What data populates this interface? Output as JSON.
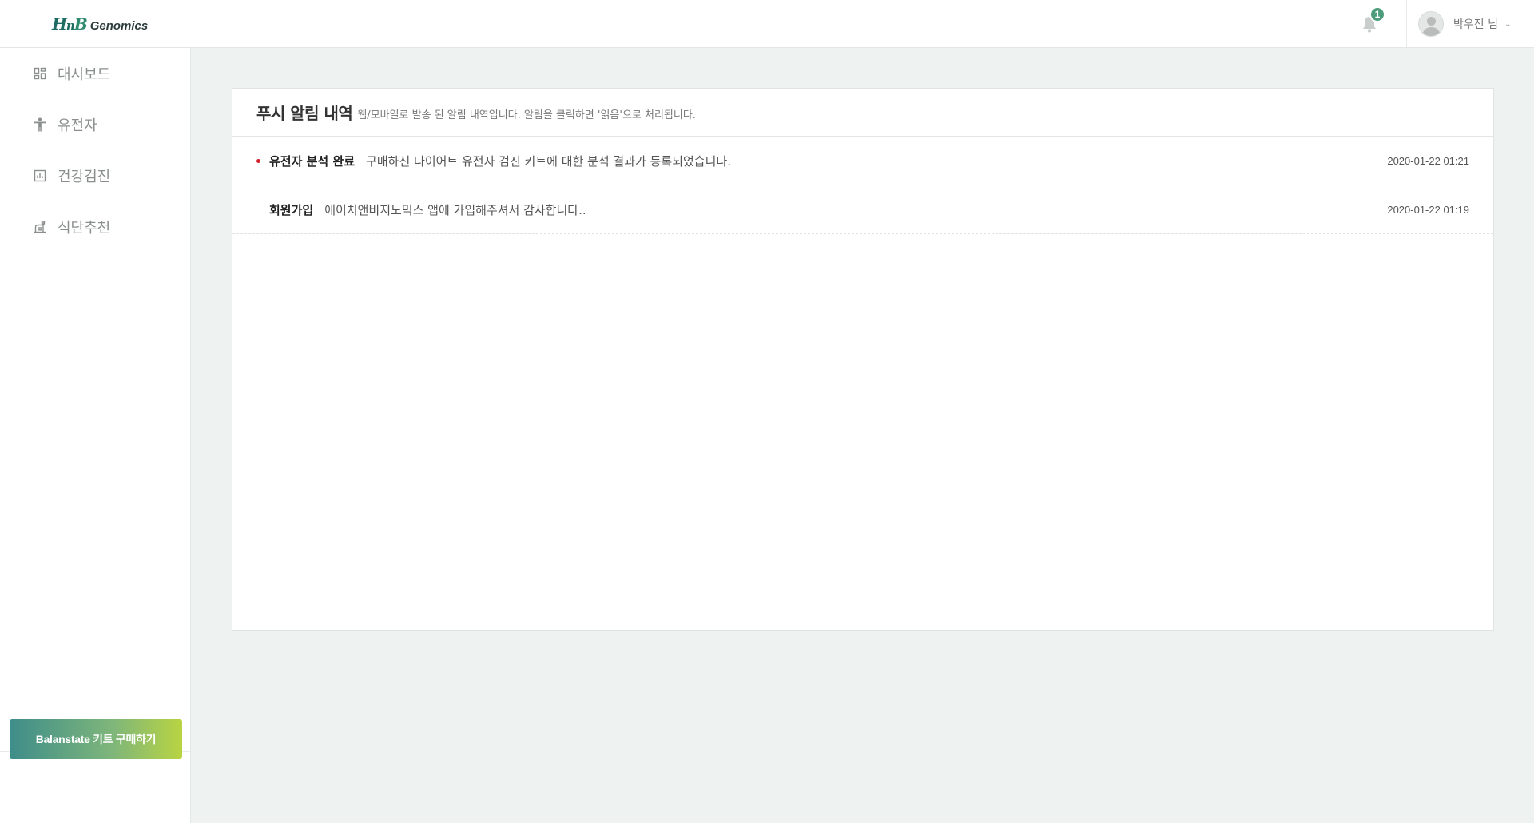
{
  "header": {
    "logo_mark_h": "H",
    "logo_mark_n": "n",
    "logo_mark_b": "B",
    "logo_word": "Genomics",
    "notification_count": "1",
    "user_name": "박우진 님",
    "user_caret": "⌄"
  },
  "sidebar": {
    "items": [
      {
        "label": "대시보드",
        "icon": "dashboard-icon"
      },
      {
        "label": "유전자",
        "icon": "person-icon"
      },
      {
        "label": "건강검진",
        "icon": "chart-icon"
      },
      {
        "label": "식단추천",
        "icon": "meal-icon"
      }
    ],
    "buy_button_label": "Balanstate 키트 구매하기"
  },
  "card": {
    "title": "푸시 알림 내역",
    "subtitle": "웹/모바일로 발송 된 알림 내역입니다. 알림을 클릭하면 '읽음'으로 처리됩니다.",
    "notifications": [
      {
        "title": "유전자 분석 완료",
        "message": "구매하신 다이어트 유전자 검진 키트에 대한 분석 결과가 등록되었습니다.",
        "time": "2020-01-22 01:21",
        "unread": true
      },
      {
        "title": "회원가입",
        "message": "에이치앤비지노믹스 앱에 가입해주셔서 감사합니다..",
        "time": "2020-01-22 01:19",
        "unread": false
      }
    ]
  },
  "colors": {
    "accent": "#4d9c7b",
    "unread_dot": "#d4202a",
    "page_bg": "#eef3f1"
  }
}
